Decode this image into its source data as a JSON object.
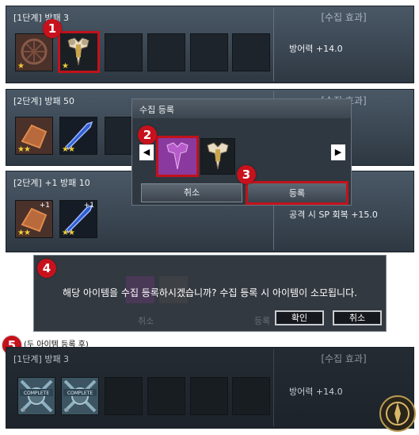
{
  "panels": [
    {
      "title": "[1단계] 방패 3",
      "effect_header": "[수집 효과]",
      "effect_value": "방어력 +14.0"
    },
    {
      "title": "[2단계] 방패 50",
      "effect_header": "[수집 효과]",
      "effect_value": ""
    },
    {
      "title": "[2단계] +1 방패 10",
      "effect_header": "",
      "effect_value": "공격 시 SP 회복 +15.0"
    }
  ],
  "item_badges": {
    "plus_one": "+1"
  },
  "register_popup": {
    "title": "수집 등록",
    "cancel_label": "취소",
    "register_label": "등록",
    "left_arrow": "◀",
    "right_arrow": "▶"
  },
  "confirm_dialog": {
    "message": "해당 아이템을 수집 등록하시겠습니까? 수집 등록 시 아이템이 소모됩니다.",
    "confirm_label": "확인",
    "cancel_label": "취소",
    "faded_behind": [
      "취소",
      "등록"
    ]
  },
  "after_caption": "(두 아이템 등록 후)",
  "after_panel": {
    "title": "[1단계] 방패 3",
    "effect_header": "[수집 효과]",
    "effect_value": "방어력 +14.0",
    "badge": "COMPLETE"
  },
  "markers": [
    "1",
    "2",
    "3",
    "4",
    "5"
  ],
  "colors": {
    "marker_red": "#c7111c",
    "star_gold": "#f2cc38",
    "panel": "#3f4b57"
  }
}
